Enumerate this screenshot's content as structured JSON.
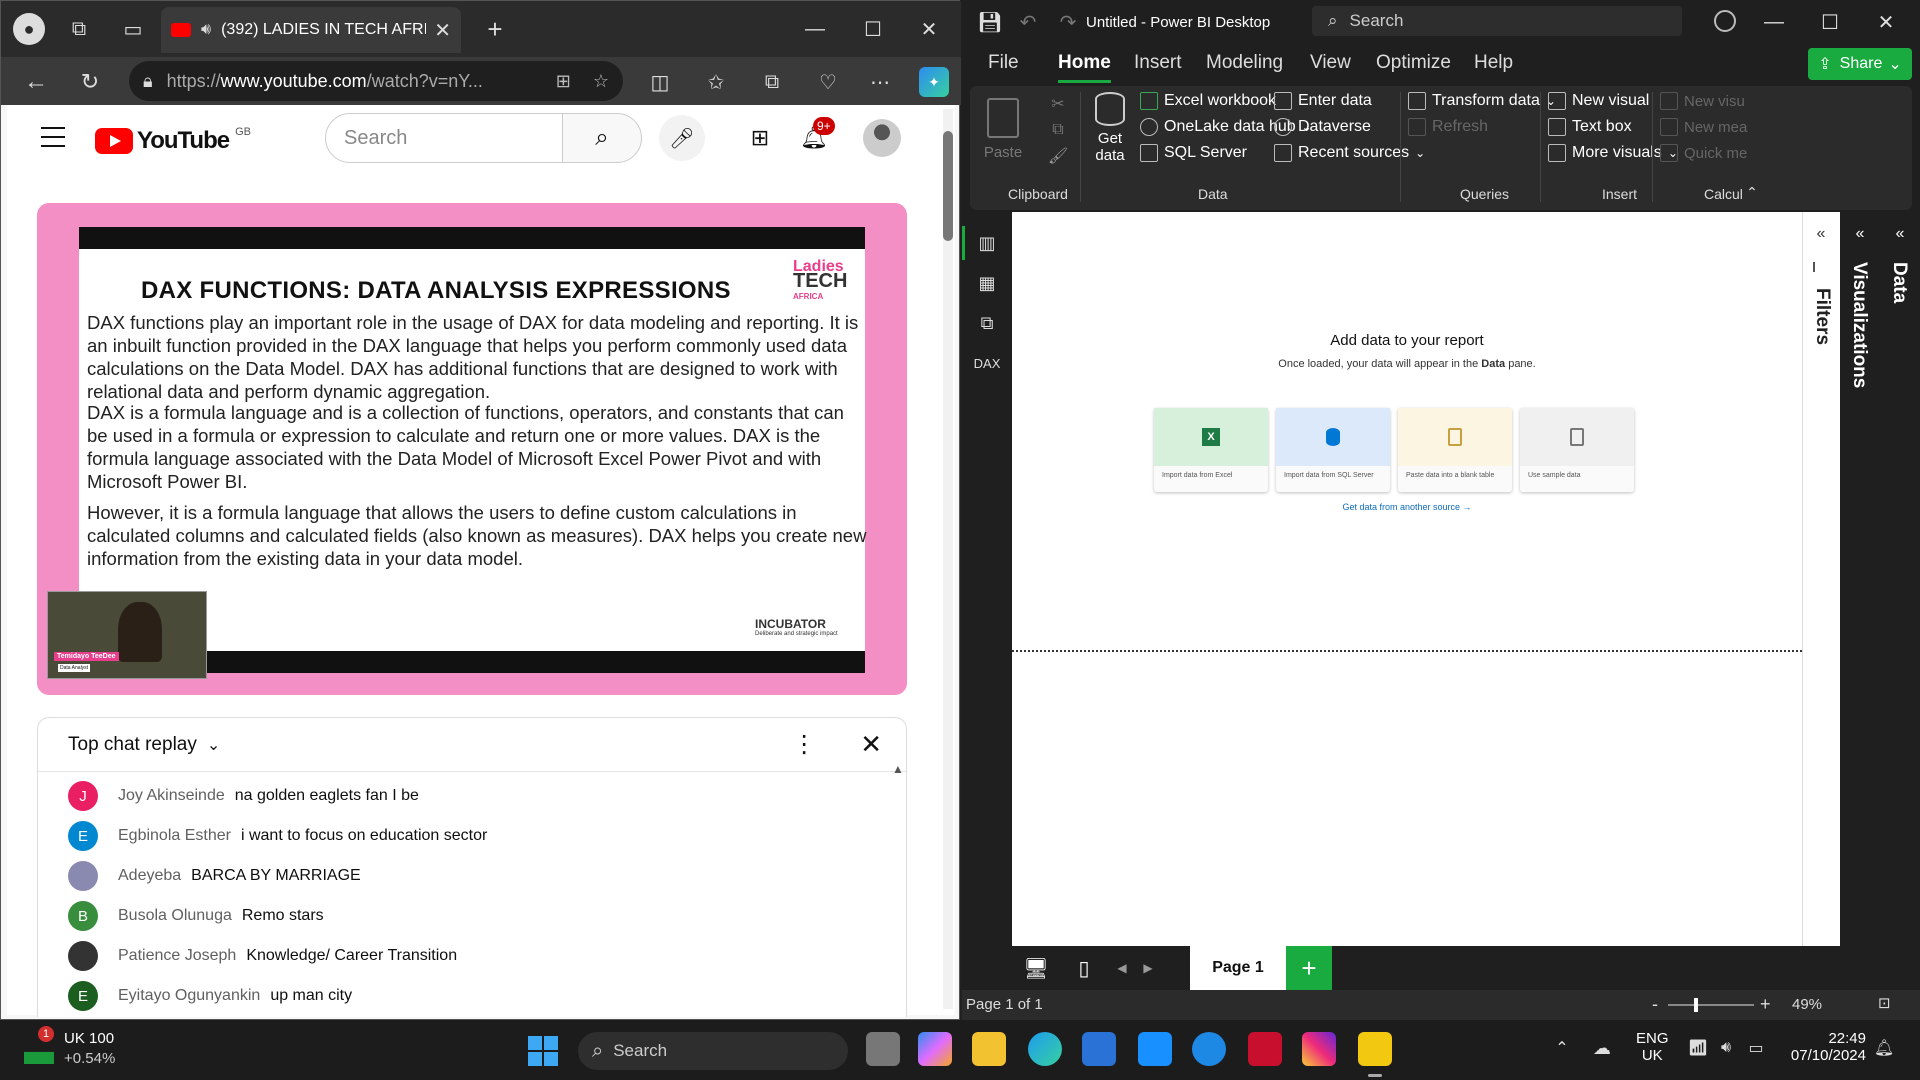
{
  "edge": {
    "tab_title": "(392) LADIES IN TECH AFRIC",
    "url_prefix": "https://",
    "url_domain": "www.youtube.com",
    "url_rest": "/watch?v=nY..."
  },
  "youtube": {
    "logo": "YouTube",
    "region": "GB",
    "search_placeholder": "Search",
    "notif_badge": "9+",
    "slide": {
      "title": "DAX FUNCTIONS: DATA ANALYSIS EXPRESSIONS",
      "p1": "DAX functions play an important role in the usage of DAX for data modeling and reporting. It is an inbuilt function provided in the DAX language that helps you perform commonly used data calculations on the Data Model. DAX has additional functions that are designed to work with relational data and perform dynamic aggregation.",
      "p2": "DAX is a formula language and is a collection of functions, operators, and constants that can be used in a formula or expression to calculate and return one or more values. DAX is the formula language associated with the Data Model of Microsoft Excel Power Pivot and with Microsoft Power BI.",
      "p3": "However, it is a formula language that allows the users to define custom calculations in calculated columns and calculated fields (also known as measures). DAX helps you create new information from the existing data in your data model.",
      "brand_line1": "Ladies",
      "brand_line2": "TECH",
      "brand_line3": "AFRICA",
      "sponsor": "INCUBATOR",
      "sponsor_sub": "Deliberate and strategic impact",
      "presenter": "Temidayo TeeDee",
      "presenter_role": "Data Analyst"
    },
    "chat": {
      "header": "Top chat replay",
      "messages": [
        {
          "initial": "J",
          "color": "#e91e63",
          "name": "Joy Akinseinde",
          "text": "na golden eaglets fan I be"
        },
        {
          "initial": "E",
          "color": "#0288d1",
          "name": "Egbinola Esther",
          "text": "i want to focus on education sector"
        },
        {
          "initial": "",
          "color": "#8a8ab0",
          "name": "Adeyeba",
          "text": "BARCA BY MARRIAGE"
        },
        {
          "initial": "B",
          "color": "#388e3c",
          "name": "Busola Olunuga",
          "text": "Remo stars"
        },
        {
          "initial": "",
          "color": "#333333",
          "name": "Patience Joseph",
          "text": "Knowledge/ Career Transition"
        },
        {
          "initial": "E",
          "color": "#1b5e20",
          "name": "Eyitayo Ogunyankin",
          "text": "up man city"
        }
      ]
    }
  },
  "pbi": {
    "title": "Untitled - Power BI Desktop",
    "search": "Search",
    "menu": [
      "File",
      "Home",
      "Insert",
      "Modeling",
      "View",
      "Optimize",
      "Help"
    ],
    "share": "Share",
    "ribbon": {
      "paste": "Paste",
      "get_data_1": "Get",
      "get_data_2": "data",
      "excel": "Excel workbook",
      "onelake": "OneLake data hub",
      "sql": "SQL Server",
      "enter_data": "Enter data",
      "dataverse": "Dataverse",
      "recent": "Recent sources",
      "transform": "Transform data",
      "refresh": "Refresh",
      "new_visual": "New visual",
      "text_box": "Text box",
      "more_visuals": "More visuals",
      "new_visu": "New visu",
      "new_mea": "New mea",
      "quick_me": "Quick me",
      "groups": {
        "clipboard": "Clipboard",
        "data": "Data",
        "queries": "Queries",
        "insert": "Insert",
        "calc": "Calcul"
      }
    },
    "canvas": {
      "heading": "Add data to your report",
      "sub_pre": "Once loaded, your data will appear in the ",
      "sub_bold": "Data",
      "sub_post": " pane.",
      "cards": [
        "Import data from Excel",
        "Import data from SQL Server",
        "Paste data into a blank table",
        "Use sample data"
      ],
      "link": "Get data from another source →"
    },
    "panes": {
      "filters": "Filters",
      "viz": "Visualizations",
      "data": "Data"
    },
    "page_tab": "Page 1",
    "status_page": "Page 1 of 1",
    "zoom": "49%"
  },
  "taskbar": {
    "stock_name": "UK 100",
    "stock_change": "+0.54%",
    "stock_badge": "1",
    "search": "Search",
    "lang1": "ENG",
    "lang2": "UK",
    "time": "22:49",
    "date": "07/10/2024"
  }
}
